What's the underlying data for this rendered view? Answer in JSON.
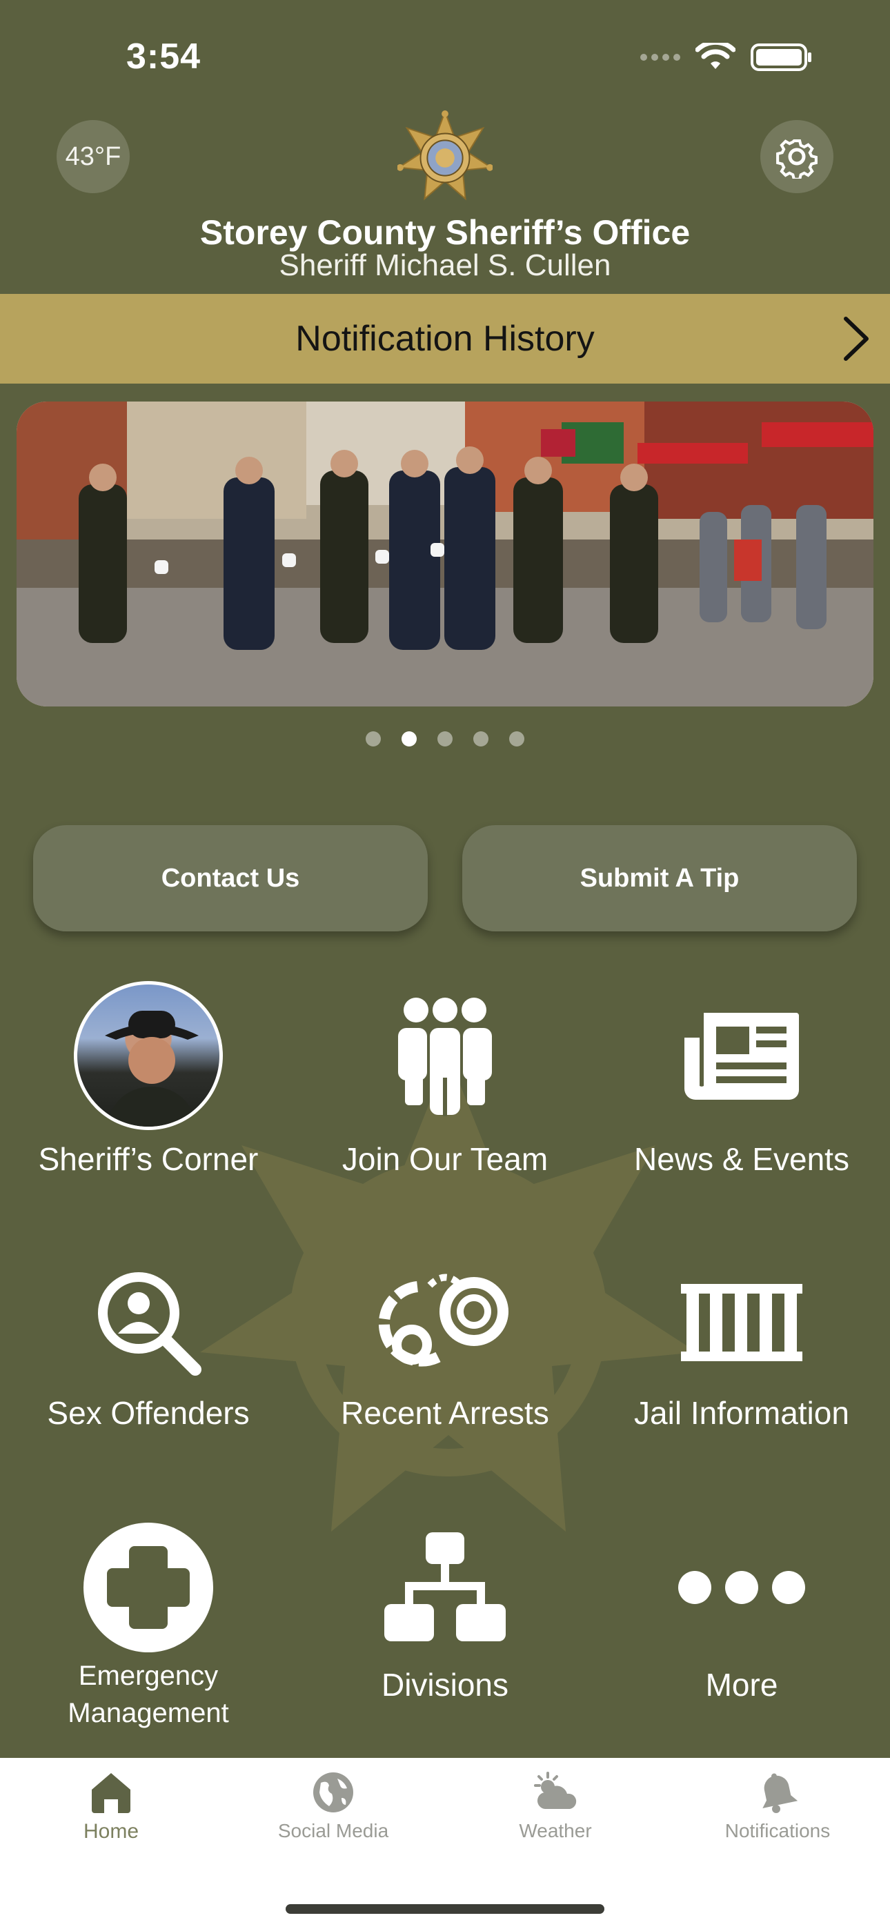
{
  "status_bar": {
    "time": "3:54"
  },
  "header": {
    "temperature": "43°F",
    "title": "Storey County Sheriff’s Office",
    "subtitle": "Sheriff Michael S. Cullen"
  },
  "notification_bar": {
    "label": "Notification History"
  },
  "carousel": {
    "page_count": 5,
    "active_index": 1
  },
  "actions": {
    "contact": "Contact Us",
    "tip": "Submit A Tip"
  },
  "grid": {
    "sheriffs_corner": "Sheriff’s Corner",
    "join_team": "Join Our Team",
    "news_events": "News & Events",
    "sex_offenders": "Sex Offenders",
    "recent_arrests": "Recent Arrests",
    "jail_info": "Jail Information",
    "emergency_line1": "Emergency",
    "emergency_line2": "Management",
    "divisions": "Divisions",
    "more": "More"
  },
  "tabbar": {
    "home": "Home",
    "social": "Social Media",
    "weather": "Weather",
    "notifications": "Notifications"
  },
  "colors": {
    "background": "#5b603f",
    "accent_gold": "#b7a35d",
    "button": "#6f745a"
  }
}
